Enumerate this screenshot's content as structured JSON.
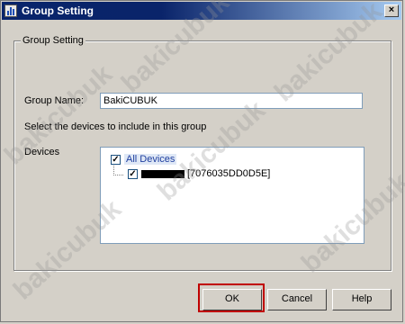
{
  "window": {
    "title": "Group Setting",
    "close_symbol": "×"
  },
  "group_box": {
    "legend": "Group Setting"
  },
  "form": {
    "group_name_label": "Group Name:",
    "group_name_value": "BakiCUBUK",
    "instruction": "Select the devices to include in this group",
    "devices_label": "Devices"
  },
  "devices_tree": {
    "root": {
      "label": "All Devices",
      "checked": true
    },
    "children": [
      {
        "label": "[7076035DD0D5E]",
        "checked": true
      }
    ]
  },
  "buttons": {
    "ok": "OK",
    "cancel": "Cancel",
    "help": "Help"
  },
  "watermark": "bakicubuk",
  "colors": {
    "highlight_border": "#c00000",
    "title_bar": "#0a246a"
  }
}
